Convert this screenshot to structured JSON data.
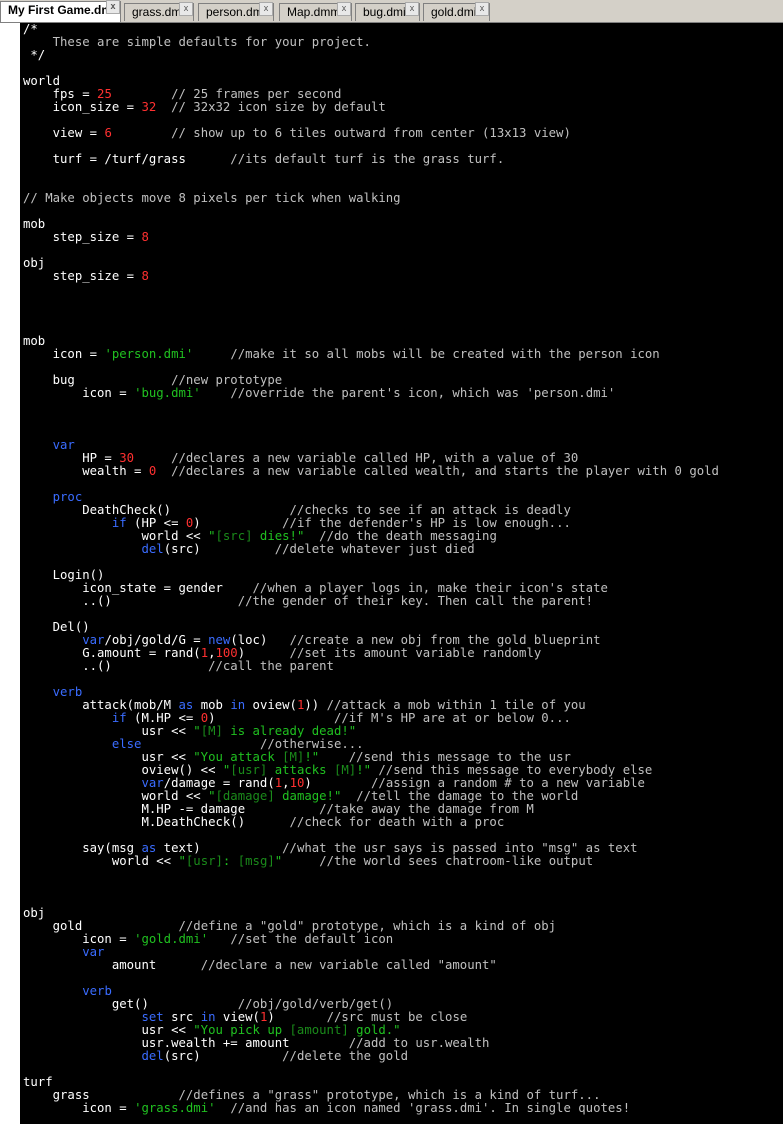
{
  "tabs": [
    "My First Game.dm",
    "grass.dmi",
    "person.dmi",
    "Map.dmm",
    "bug.dmi",
    "gold.dmi"
  ],
  "tab_close_glyph": "x",
  "colors": {
    "default": "#ffffff",
    "comment": "#c0c0c0",
    "keyword": "#3a6cff",
    "number": "#ff3030",
    "string": "#20c020",
    "embedded": "#1a8a1a"
  },
  "code": [
    {
      "t": "/*"
    },
    {
      "t": "    These are simple defaults for your project.",
      "c": "c"
    },
    {
      "t": " */"
    },
    {
      "t": ""
    },
    {
      "t": "world"
    },
    {
      "seg": [
        [
          "    fps = ",
          ""
        ],
        [
          "25",
          "n"
        ],
        [
          "        ",
          ""
        ],
        [
          "// 25 frames per second",
          "c"
        ]
      ]
    },
    {
      "seg": [
        [
          "    icon_size = ",
          ""
        ],
        [
          "32",
          "n"
        ],
        [
          "  ",
          ""
        ],
        [
          "// 32x32 icon size by default",
          "c"
        ]
      ]
    },
    {
      "t": ""
    },
    {
      "seg": [
        [
          "    view = ",
          ""
        ],
        [
          "6",
          "n"
        ],
        [
          "        ",
          ""
        ],
        [
          "// show up to 6 tiles outward from center (13x13 view)",
          "c"
        ]
      ]
    },
    {
      "t": ""
    },
    {
      "seg": [
        [
          "    turf = /turf/grass      ",
          ""
        ],
        [
          "//its default turf is the grass turf.",
          "c"
        ]
      ]
    },
    {
      "t": ""
    },
    {
      "t": ""
    },
    {
      "t": "// Make objects move 8 pixels per tick when walking",
      "c": "c"
    },
    {
      "t": ""
    },
    {
      "t": "mob"
    },
    {
      "seg": [
        [
          "    step_size = ",
          ""
        ],
        [
          "8",
          "n"
        ]
      ]
    },
    {
      "t": ""
    },
    {
      "t": "obj"
    },
    {
      "seg": [
        [
          "    step_size = ",
          ""
        ],
        [
          "8",
          "n"
        ]
      ]
    },
    {
      "t": ""
    },
    {
      "t": ""
    },
    {
      "t": ""
    },
    {
      "t": ""
    },
    {
      "t": "mob"
    },
    {
      "seg": [
        [
          "    icon = ",
          ""
        ],
        [
          "'person.dmi'",
          "s"
        ],
        [
          "     ",
          ""
        ],
        [
          "//make it so all mobs will be created with the person icon",
          "c"
        ]
      ]
    },
    {
      "t": ""
    },
    {
      "seg": [
        [
          "    bug             ",
          ""
        ],
        [
          "//new prototype",
          "c"
        ]
      ]
    },
    {
      "seg": [
        [
          "        icon = ",
          ""
        ],
        [
          "'bug.dmi'",
          "s"
        ],
        [
          "    ",
          ""
        ],
        [
          "//override the parent's icon, which was 'person.dmi'",
          "c"
        ]
      ]
    },
    {
      "t": ""
    },
    {
      "t": ""
    },
    {
      "t": ""
    },
    {
      "seg": [
        [
          "    ",
          ""
        ],
        [
          "var",
          "k"
        ]
      ]
    },
    {
      "seg": [
        [
          "        HP = ",
          ""
        ],
        [
          "30",
          "n"
        ],
        [
          "     ",
          ""
        ],
        [
          "//declares a new variable called HP, with a value of 30",
          "c"
        ]
      ]
    },
    {
      "seg": [
        [
          "        wealth = ",
          ""
        ],
        [
          "0",
          "n"
        ],
        [
          "  ",
          ""
        ],
        [
          "//declares a new variable called wealth, and starts the player with 0 gold",
          "c"
        ]
      ]
    },
    {
      "t": ""
    },
    {
      "seg": [
        [
          "    ",
          ""
        ],
        [
          "proc",
          "k"
        ]
      ]
    },
    {
      "seg": [
        [
          "        DeathCheck()                ",
          ""
        ],
        [
          "//checks to see if an attack is deadly",
          "c"
        ]
      ]
    },
    {
      "seg": [
        [
          "            ",
          ""
        ],
        [
          "if",
          "k"
        ],
        [
          " (HP <= ",
          ""
        ],
        [
          "0",
          "n"
        ],
        [
          ")           ",
          ""
        ],
        [
          "//if the defender's HP is low enough...",
          "c"
        ]
      ]
    },
    {
      "seg": [
        [
          "                world << ",
          ""
        ],
        [
          "\"",
          "s"
        ],
        [
          "[src]",
          "e"
        ],
        [
          " dies!\"",
          "s"
        ],
        [
          "  ",
          ""
        ],
        [
          "//do the death messaging",
          "c"
        ]
      ]
    },
    {
      "seg": [
        [
          "                ",
          ""
        ],
        [
          "del",
          "k"
        ],
        [
          "(src)          ",
          ""
        ],
        [
          "//delete whatever just died",
          "c"
        ]
      ]
    },
    {
      "t": ""
    },
    {
      "t": "    Login()"
    },
    {
      "seg": [
        [
          "        icon_state = gender    ",
          ""
        ],
        [
          "//when a player logs in, make their icon's state",
          "c"
        ]
      ]
    },
    {
      "seg": [
        [
          "        ..()                 ",
          ""
        ],
        [
          "//the gender of their key. Then call the parent!",
          "c"
        ]
      ]
    },
    {
      "t": ""
    },
    {
      "t": "    Del()"
    },
    {
      "seg": [
        [
          "        ",
          ""
        ],
        [
          "var",
          "k"
        ],
        [
          "/obj/gold/G = ",
          ""
        ],
        [
          "new",
          "k"
        ],
        [
          "(loc)   ",
          ""
        ],
        [
          "//create a new obj from the gold blueprint",
          "c"
        ]
      ]
    },
    {
      "seg": [
        [
          "        G.amount = rand(",
          ""
        ],
        [
          "1",
          "n"
        ],
        [
          ",",
          ""
        ],
        [
          "100",
          "n"
        ],
        [
          ")      ",
          ""
        ],
        [
          "//set its amount variable randomly",
          "c"
        ]
      ]
    },
    {
      "seg": [
        [
          "        ..()             ",
          ""
        ],
        [
          "//call the parent",
          "c"
        ]
      ]
    },
    {
      "t": ""
    },
    {
      "seg": [
        [
          "    ",
          ""
        ],
        [
          "verb",
          "k"
        ]
      ]
    },
    {
      "seg": [
        [
          "        attack(mob/M ",
          ""
        ],
        [
          "as",
          "k"
        ],
        [
          " mob ",
          ""
        ],
        [
          "in",
          "k"
        ],
        [
          " oview(",
          ""
        ],
        [
          "1",
          "n"
        ],
        [
          ")) ",
          ""
        ],
        [
          "//attack a mob within 1 tile of you",
          "c"
        ]
      ]
    },
    {
      "seg": [
        [
          "            ",
          ""
        ],
        [
          "if",
          "k"
        ],
        [
          " (M.HP <= ",
          ""
        ],
        [
          "0",
          "n"
        ],
        [
          ")                ",
          ""
        ],
        [
          "//if M's HP are at or below 0...",
          "c"
        ]
      ]
    },
    {
      "seg": [
        [
          "                usr << ",
          ""
        ],
        [
          "\"",
          "s"
        ],
        [
          "[M]",
          "e"
        ],
        [
          " is already dead!\"",
          "s"
        ]
      ]
    },
    {
      "seg": [
        [
          "            ",
          ""
        ],
        [
          "else",
          "k"
        ],
        [
          "                ",
          ""
        ],
        [
          "//otherwise...",
          "c"
        ]
      ]
    },
    {
      "seg": [
        [
          "                usr << ",
          ""
        ],
        [
          "\"You attack ",
          "s"
        ],
        [
          "[M]",
          "e"
        ],
        [
          "!\"",
          "s"
        ],
        [
          "    ",
          ""
        ],
        [
          "//send this message to the usr",
          "c"
        ]
      ]
    },
    {
      "seg": [
        [
          "                oview() << ",
          ""
        ],
        [
          "\"",
          "s"
        ],
        [
          "[usr]",
          "e"
        ],
        [
          " attacks ",
          "s"
        ],
        [
          "[M]",
          "e"
        ],
        [
          "!\"",
          "s"
        ],
        [
          " ",
          ""
        ],
        [
          "//send this message to everybody else",
          "c"
        ]
      ]
    },
    {
      "seg": [
        [
          "                ",
          ""
        ],
        [
          "var",
          "k"
        ],
        [
          "/damage = rand(",
          ""
        ],
        [
          "1",
          "n"
        ],
        [
          ",",
          ""
        ],
        [
          "10",
          "n"
        ],
        [
          ")        ",
          ""
        ],
        [
          "//assign a random # to a new variable",
          "c"
        ]
      ]
    },
    {
      "seg": [
        [
          "                world << ",
          ""
        ],
        [
          "\"",
          "s"
        ],
        [
          "[damage]",
          "e"
        ],
        [
          " damage!\"",
          "s"
        ],
        [
          "  ",
          ""
        ],
        [
          "//tell the damage to the world",
          "c"
        ]
      ]
    },
    {
      "seg": [
        [
          "                M.HP -= damage          ",
          ""
        ],
        [
          "//take away the damage from M",
          "c"
        ]
      ]
    },
    {
      "seg": [
        [
          "                M.DeathCheck()      ",
          ""
        ],
        [
          "//check for death with a proc",
          "c"
        ]
      ]
    },
    {
      "t": ""
    },
    {
      "seg": [
        [
          "        say(msg ",
          ""
        ],
        [
          "as",
          "k"
        ],
        [
          " text)           ",
          ""
        ],
        [
          "//what the usr says is passed into \"msg\" as text",
          "c"
        ]
      ]
    },
    {
      "seg": [
        [
          "            world << ",
          ""
        ],
        [
          "\"",
          "s"
        ],
        [
          "[usr]",
          "e"
        ],
        [
          ": ",
          "s"
        ],
        [
          "[msg]",
          "e"
        ],
        [
          "\"",
          "s"
        ],
        [
          "     ",
          ""
        ],
        [
          "//the world sees chatroom-like output",
          "c"
        ]
      ]
    },
    {
      "t": ""
    },
    {
      "t": ""
    },
    {
      "t": ""
    },
    {
      "t": "obj"
    },
    {
      "seg": [
        [
          "    gold             ",
          ""
        ],
        [
          "//define a \"gold\" prototype, which is a kind of obj",
          "c"
        ]
      ]
    },
    {
      "seg": [
        [
          "        icon = ",
          ""
        ],
        [
          "'gold.dmi'",
          "s"
        ],
        [
          "   ",
          ""
        ],
        [
          "//set the default icon",
          "c"
        ]
      ]
    },
    {
      "seg": [
        [
          "        ",
          ""
        ],
        [
          "var",
          "k"
        ]
      ]
    },
    {
      "seg": [
        [
          "            amount      ",
          ""
        ],
        [
          "//declare a new variable called \"amount\"",
          "c"
        ]
      ]
    },
    {
      "t": ""
    },
    {
      "seg": [
        [
          "        ",
          ""
        ],
        [
          "verb",
          "k"
        ]
      ]
    },
    {
      "seg": [
        [
          "            get()            ",
          ""
        ],
        [
          "//obj/gold/verb/get()",
          "c"
        ]
      ]
    },
    {
      "seg": [
        [
          "                ",
          ""
        ],
        [
          "set",
          "k"
        ],
        [
          " src ",
          ""
        ],
        [
          "in",
          "k"
        ],
        [
          " view(",
          ""
        ],
        [
          "1",
          "n"
        ],
        [
          ")       ",
          ""
        ],
        [
          "//src must be close",
          "c"
        ]
      ]
    },
    {
      "seg": [
        [
          "                usr << ",
          ""
        ],
        [
          "\"You pick up ",
          "s"
        ],
        [
          "[amount]",
          "e"
        ],
        [
          " gold.\"",
          "s"
        ]
      ]
    },
    {
      "seg": [
        [
          "                usr.wealth += amount        ",
          ""
        ],
        [
          "//add to usr.wealth",
          "c"
        ]
      ]
    },
    {
      "seg": [
        [
          "                ",
          ""
        ],
        [
          "del",
          "k"
        ],
        [
          "(src)           ",
          ""
        ],
        [
          "//delete the gold",
          "c"
        ]
      ]
    },
    {
      "t": ""
    },
    {
      "t": "turf"
    },
    {
      "seg": [
        [
          "    grass            ",
          ""
        ],
        [
          "//defines a \"grass\" prototype, which is a kind of turf...",
          "c"
        ]
      ]
    },
    {
      "seg": [
        [
          "        icon = ",
          ""
        ],
        [
          "'grass.dmi'",
          "s"
        ],
        [
          "  ",
          ""
        ],
        [
          "//and has an icon named 'grass.dmi'. In single quotes!",
          "c"
        ]
      ]
    }
  ]
}
